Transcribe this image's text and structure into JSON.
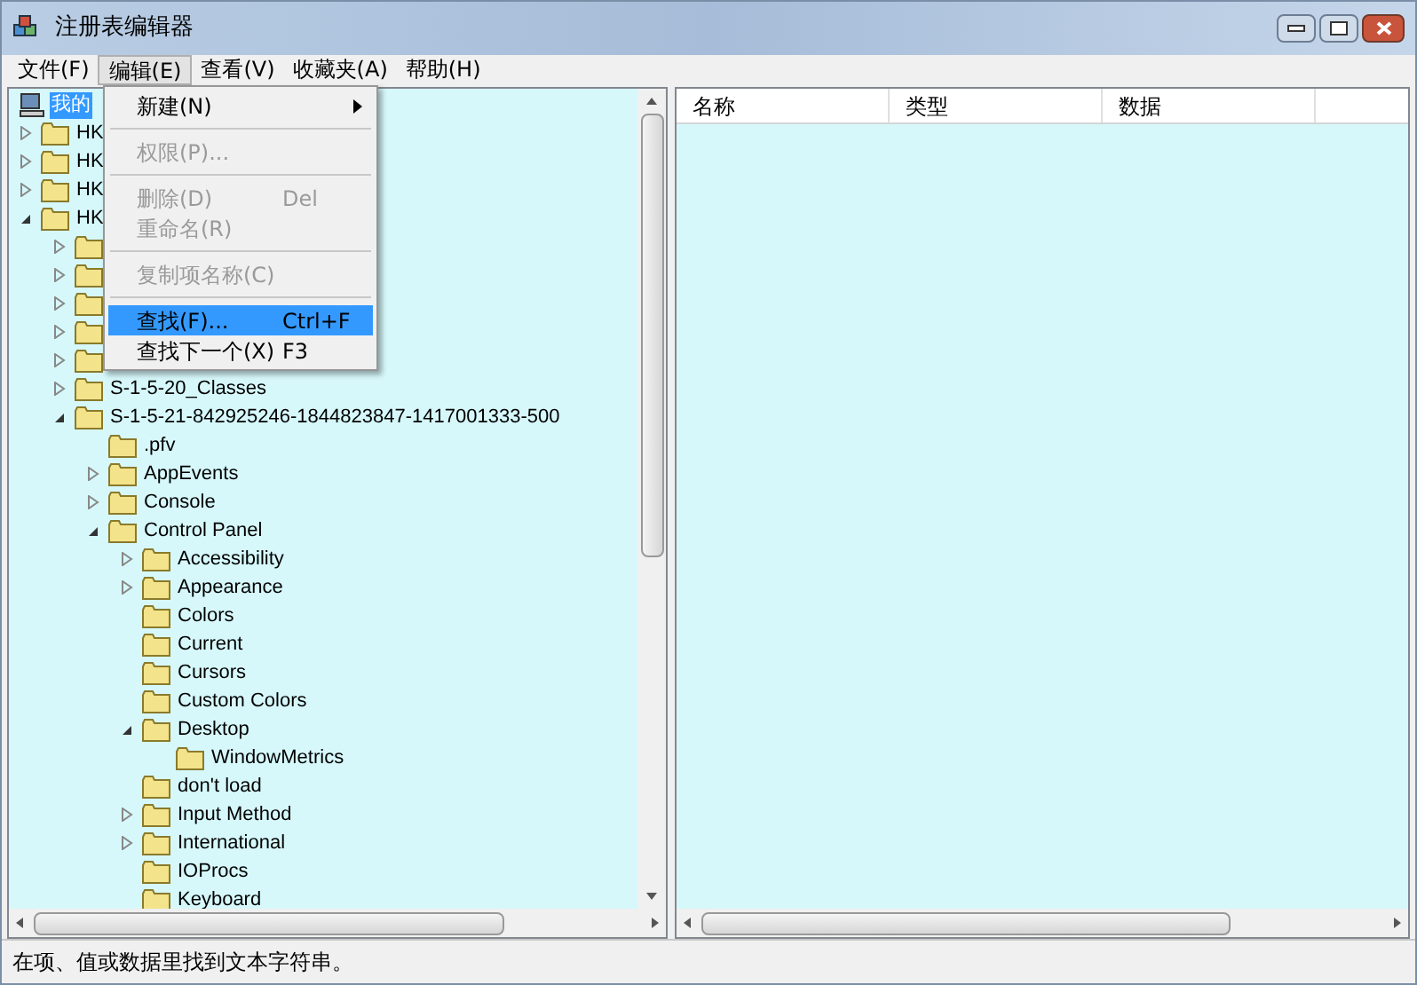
{
  "window": {
    "title": "注册表编辑器"
  },
  "menubar": [
    {
      "label": "文件(F)",
      "selected": false
    },
    {
      "label": "编辑(E)",
      "selected": true
    },
    {
      "label": "查看(V)",
      "selected": false
    },
    {
      "label": "收藏夹(A)",
      "selected": false
    },
    {
      "label": "帮助(H)",
      "selected": false
    }
  ],
  "menu": [
    {
      "kind": "item",
      "label": "新建(N)",
      "submenu": true,
      "disabled": false,
      "selected": false
    },
    {
      "kind": "separator"
    },
    {
      "kind": "item",
      "label": "权限(P)...",
      "disabled": true,
      "selected": false
    },
    {
      "kind": "separator"
    },
    {
      "kind": "item",
      "label": "删除(D)",
      "shortcut": "Del",
      "disabled": true,
      "selected": false
    },
    {
      "kind": "item",
      "label": "重命名(R)",
      "disabled": true,
      "selected": false
    },
    {
      "kind": "separator"
    },
    {
      "kind": "item",
      "label": "复制项名称(C)",
      "disabled": true,
      "selected": false
    },
    {
      "kind": "separator"
    },
    {
      "kind": "item",
      "label": "查找(F)...",
      "shortcut": "Ctrl+F",
      "disabled": false,
      "selected": true
    },
    {
      "kind": "item",
      "label": "查找下一个(X)",
      "shortcut": "F3",
      "disabled": false,
      "selected": false
    }
  ],
  "tree": [
    {
      "label": "我的",
      "selected": true,
      "children": [
        {
          "label": "HK",
          "expanded": false,
          "selected": false
        },
        {
          "label": "HK",
          "expanded": false,
          "selected": false
        },
        {
          "label": "HK",
          "expanded": false,
          "selected": false
        },
        {
          "label": "HK",
          "expanded": true,
          "selected": false,
          "children": [
            {
              "expanded": false
            },
            {
              "expanded": false
            },
            {
              "expanded": false
            },
            {
              "expanded": false
            },
            {
              "expanded": false
            },
            {
              "label": "S-1-5-20_Classes",
              "expanded": false,
              "selected": false
            },
            {
              "label": "S-1-5-21-842925246-1844823847-1417001333-500",
              "expanded": true,
              "selected": false,
              "children": [
                {
                  "label": ".pfv",
                  "selected": false
                },
                {
                  "label": "AppEvents",
                  "expanded": false,
                  "selected": false
                },
                {
                  "label": "Console",
                  "expanded": false,
                  "selected": false
                },
                {
                  "label": "Control Panel",
                  "expanded": true,
                  "selected": false,
                  "children": [
                    {
                      "label": "Accessibility",
                      "expanded": false,
                      "selected": false
                    },
                    {
                      "label": "Appearance",
                      "expanded": false,
                      "selected": false
                    },
                    {
                      "label": "Colors",
                      "selected": false
                    },
                    {
                      "label": "Current",
                      "selected": false
                    },
                    {
                      "label": "Cursors",
                      "selected": false
                    },
                    {
                      "label": "Custom Colors",
                      "selected": false
                    },
                    {
                      "label": "Desktop",
                      "expanded": true,
                      "selected": false,
                      "children": [
                        {
                          "label": "WindowMetrics",
                          "selected": false
                        }
                      ]
                    },
                    {
                      "label": "don't load",
                      "selected": false
                    },
                    {
                      "label": "Input Method",
                      "expanded": false,
                      "selected": false
                    },
                    {
                      "label": "International",
                      "expanded": false,
                      "selected": false
                    },
                    {
                      "label": "IOProcs",
                      "selected": false
                    },
                    {
                      "label": "Keyboard",
                      "selected": false
                    }
                  ]
                }
              ]
            }
          ]
        }
      ]
    }
  ],
  "list": {
    "columns": [
      "名称",
      "类型",
      "数据"
    ]
  },
  "status_bar": "在项、值或数据里找到文本字符串。"
}
